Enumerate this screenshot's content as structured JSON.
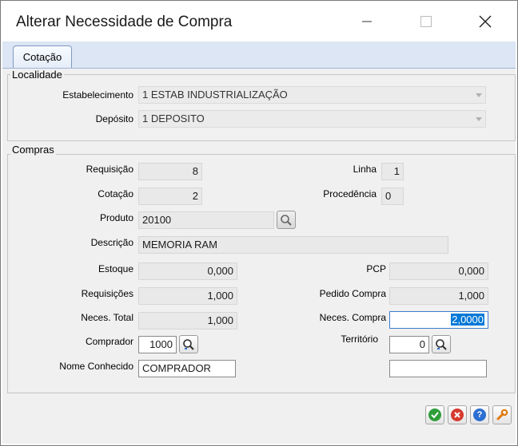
{
  "window": {
    "title": "Alterar Necessidade de Compra"
  },
  "tabs": [
    {
      "label": "Cotação"
    }
  ],
  "localidade": {
    "legend": "Localidade",
    "estabelecimento": {
      "label": "Estabelecimento",
      "value": "1 ESTAB INDUSTRIALIZAÇÃO"
    },
    "deposito": {
      "label": "Depósito",
      "value": "1 DEPOSITO"
    }
  },
  "compras": {
    "legend": "Compras",
    "requisicao": {
      "label": "Requisição",
      "value": "8"
    },
    "linha": {
      "label": "Linha",
      "value": "1"
    },
    "cotacao": {
      "label": "Cotação",
      "value": "2"
    },
    "procedencia": {
      "label": "Procedência",
      "value": "0"
    },
    "produto": {
      "label": "Produto",
      "value": "20100"
    },
    "descricao": {
      "label": "Descrição",
      "value": "MEMORIA RAM"
    },
    "estoque": {
      "label": "Estoque",
      "value": "0,000"
    },
    "pcp": {
      "label": "PCP",
      "value": "0,000"
    },
    "requisicoes": {
      "label": "Requisições",
      "value": "1,000"
    },
    "pedido_compra": {
      "label": "Pedido Compra",
      "value": "1,000"
    },
    "neces_total": {
      "label": "Neces. Total",
      "value": "1,000"
    },
    "neces_compra": {
      "label": "Neces. Compra",
      "value": "2,0000"
    },
    "comprador": {
      "label": "Comprador",
      "value": "1000"
    },
    "territorio": {
      "label": "Território",
      "value": "0"
    },
    "nome_conhecido": {
      "label": "Nome Conhecido",
      "value": "COMPRADOR"
    },
    "territorio_nome": {
      "value": ""
    }
  },
  "colors": {
    "ok": "#2e9e3a",
    "cancel": "#d63a2f",
    "help": "#2a6fd1",
    "tools": "#e07a10"
  }
}
